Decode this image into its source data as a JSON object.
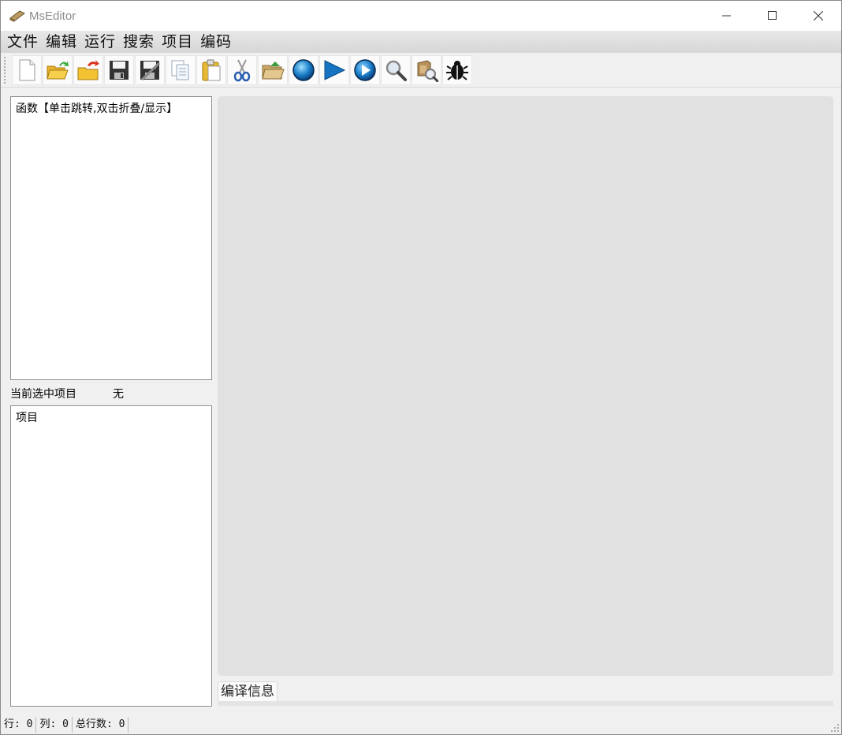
{
  "window": {
    "title": "MsEditor"
  },
  "menu": {
    "items": [
      "文件",
      "编辑",
      "运行",
      "搜索",
      "项目",
      "编码"
    ]
  },
  "toolbar": {
    "buttons": [
      {
        "icon": "new-file-icon"
      },
      {
        "icon": "open-folder-icon"
      },
      {
        "icon": "open-recent-icon"
      },
      {
        "icon": "save-icon"
      },
      {
        "icon": "save-as-icon"
      },
      {
        "icon": "copy-icon"
      },
      {
        "icon": "paste-icon"
      },
      {
        "icon": "cut-icon"
      },
      {
        "icon": "open-project-icon"
      },
      {
        "icon": "stop-icon"
      },
      {
        "icon": "run-icon"
      },
      {
        "icon": "run-debug-icon"
      },
      {
        "icon": "search-icon"
      },
      {
        "icon": "find-in-files-icon"
      },
      {
        "icon": "bug-icon"
      }
    ]
  },
  "functions_panel": {
    "header": "函数【单击跳转,双击折叠/显示】"
  },
  "current_project": {
    "label": "当前选中项目",
    "value": "无"
  },
  "project_panel": {
    "header": "项目"
  },
  "output": {
    "tab_label": "编译信息"
  },
  "status": {
    "row": "行: 0",
    "col": "列: 0",
    "total": "总行数: 0"
  },
  "colors": {
    "editor_bg": "#e1e1e1",
    "window_bg": "#f0f0f0"
  }
}
